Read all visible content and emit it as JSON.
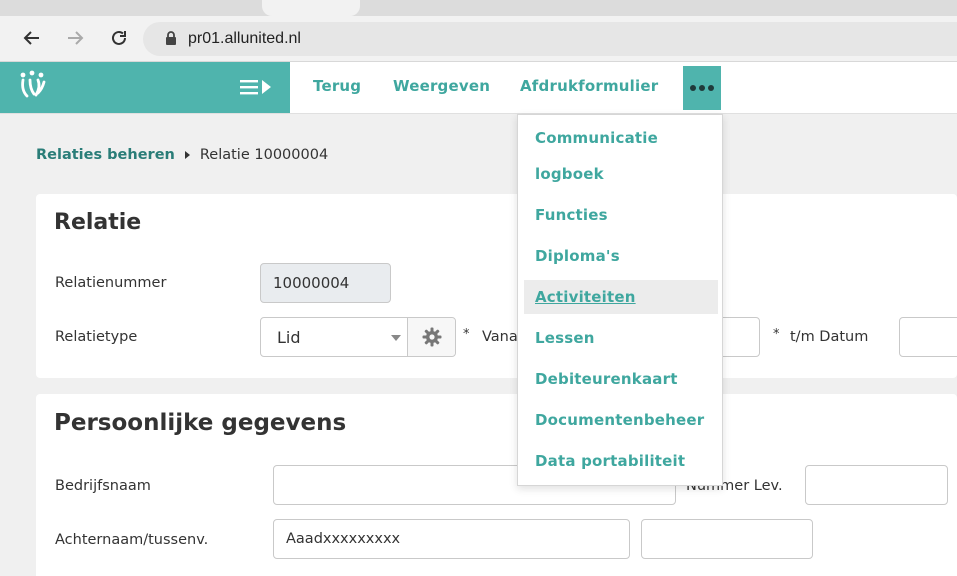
{
  "browser": {
    "url": "pr01.allunited.nl"
  },
  "header": {
    "nav": [
      "Terug",
      "Weergeven",
      "Afdrukformulier"
    ],
    "more_icon": "ellipsis-icon",
    "accent_color": "#4fb4ad"
  },
  "breadcrumb": {
    "parent": "Relaties beheren",
    "current": "Relatie 10000004"
  },
  "relatie": {
    "title": "Relatie",
    "nummer_label": "Relatienummer",
    "nummer_value": "10000004",
    "type_label": "Relatietype",
    "type_value": "Lid",
    "vanaf_label": "Vana",
    "tm_label": "t/m Datum",
    "asterisk": "*"
  },
  "persoonlijk": {
    "title": "Persoonlijke gegevens",
    "bedrijf_label": "Bedrijfsnaam",
    "bedrijf_value": "",
    "nummer_lev_label": "Nummer Lev.",
    "achternaam_label": "Achternaam/tussenv.",
    "achternaam_value": "Aaadxxxxxxxxx"
  },
  "dropdown": {
    "items": [
      "Communicatie",
      "logboek",
      "Functies",
      "Diploma's",
      "Activiteiten",
      "Lessen",
      "Debiteurenkaart",
      "Documentenbeheer",
      "Data portabiliteit"
    ],
    "active_item": "Activiteiten"
  }
}
